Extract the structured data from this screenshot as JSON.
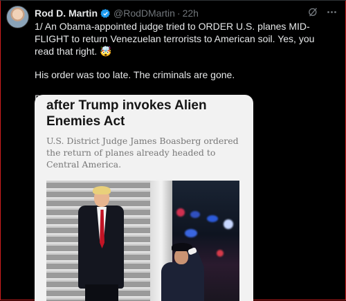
{
  "tweet": {
    "display_name": "Rod D. Martin",
    "handle": "@RodDMartin",
    "separator": "·",
    "time": "22h",
    "paragraphs": [
      "1/ An Obama-appointed judge tried to ORDER U.S. planes MID-FLIGHT to return Venezuelan terrorists to American soil. Yes, you read that right. 🤯",
      "His order was too late. The criminals are gone.",
      "But what he's doing now is even worse...."
    ]
  },
  "card": {
    "headline_lines": [
      "after Trump invokes Alien",
      "Enemies Act"
    ],
    "subtext": "U.S. District Judge James Boasberg ordered the return of planes already headed to Central America."
  },
  "icons": {
    "verified": "verified-badge-icon",
    "grok": "grok-icon",
    "more": "more-icon"
  },
  "colors": {
    "background": "#000000",
    "text": "#e7e9ea",
    "muted": "#71767b",
    "verified": "#1d9bf0",
    "frame": "#d21f1f"
  }
}
